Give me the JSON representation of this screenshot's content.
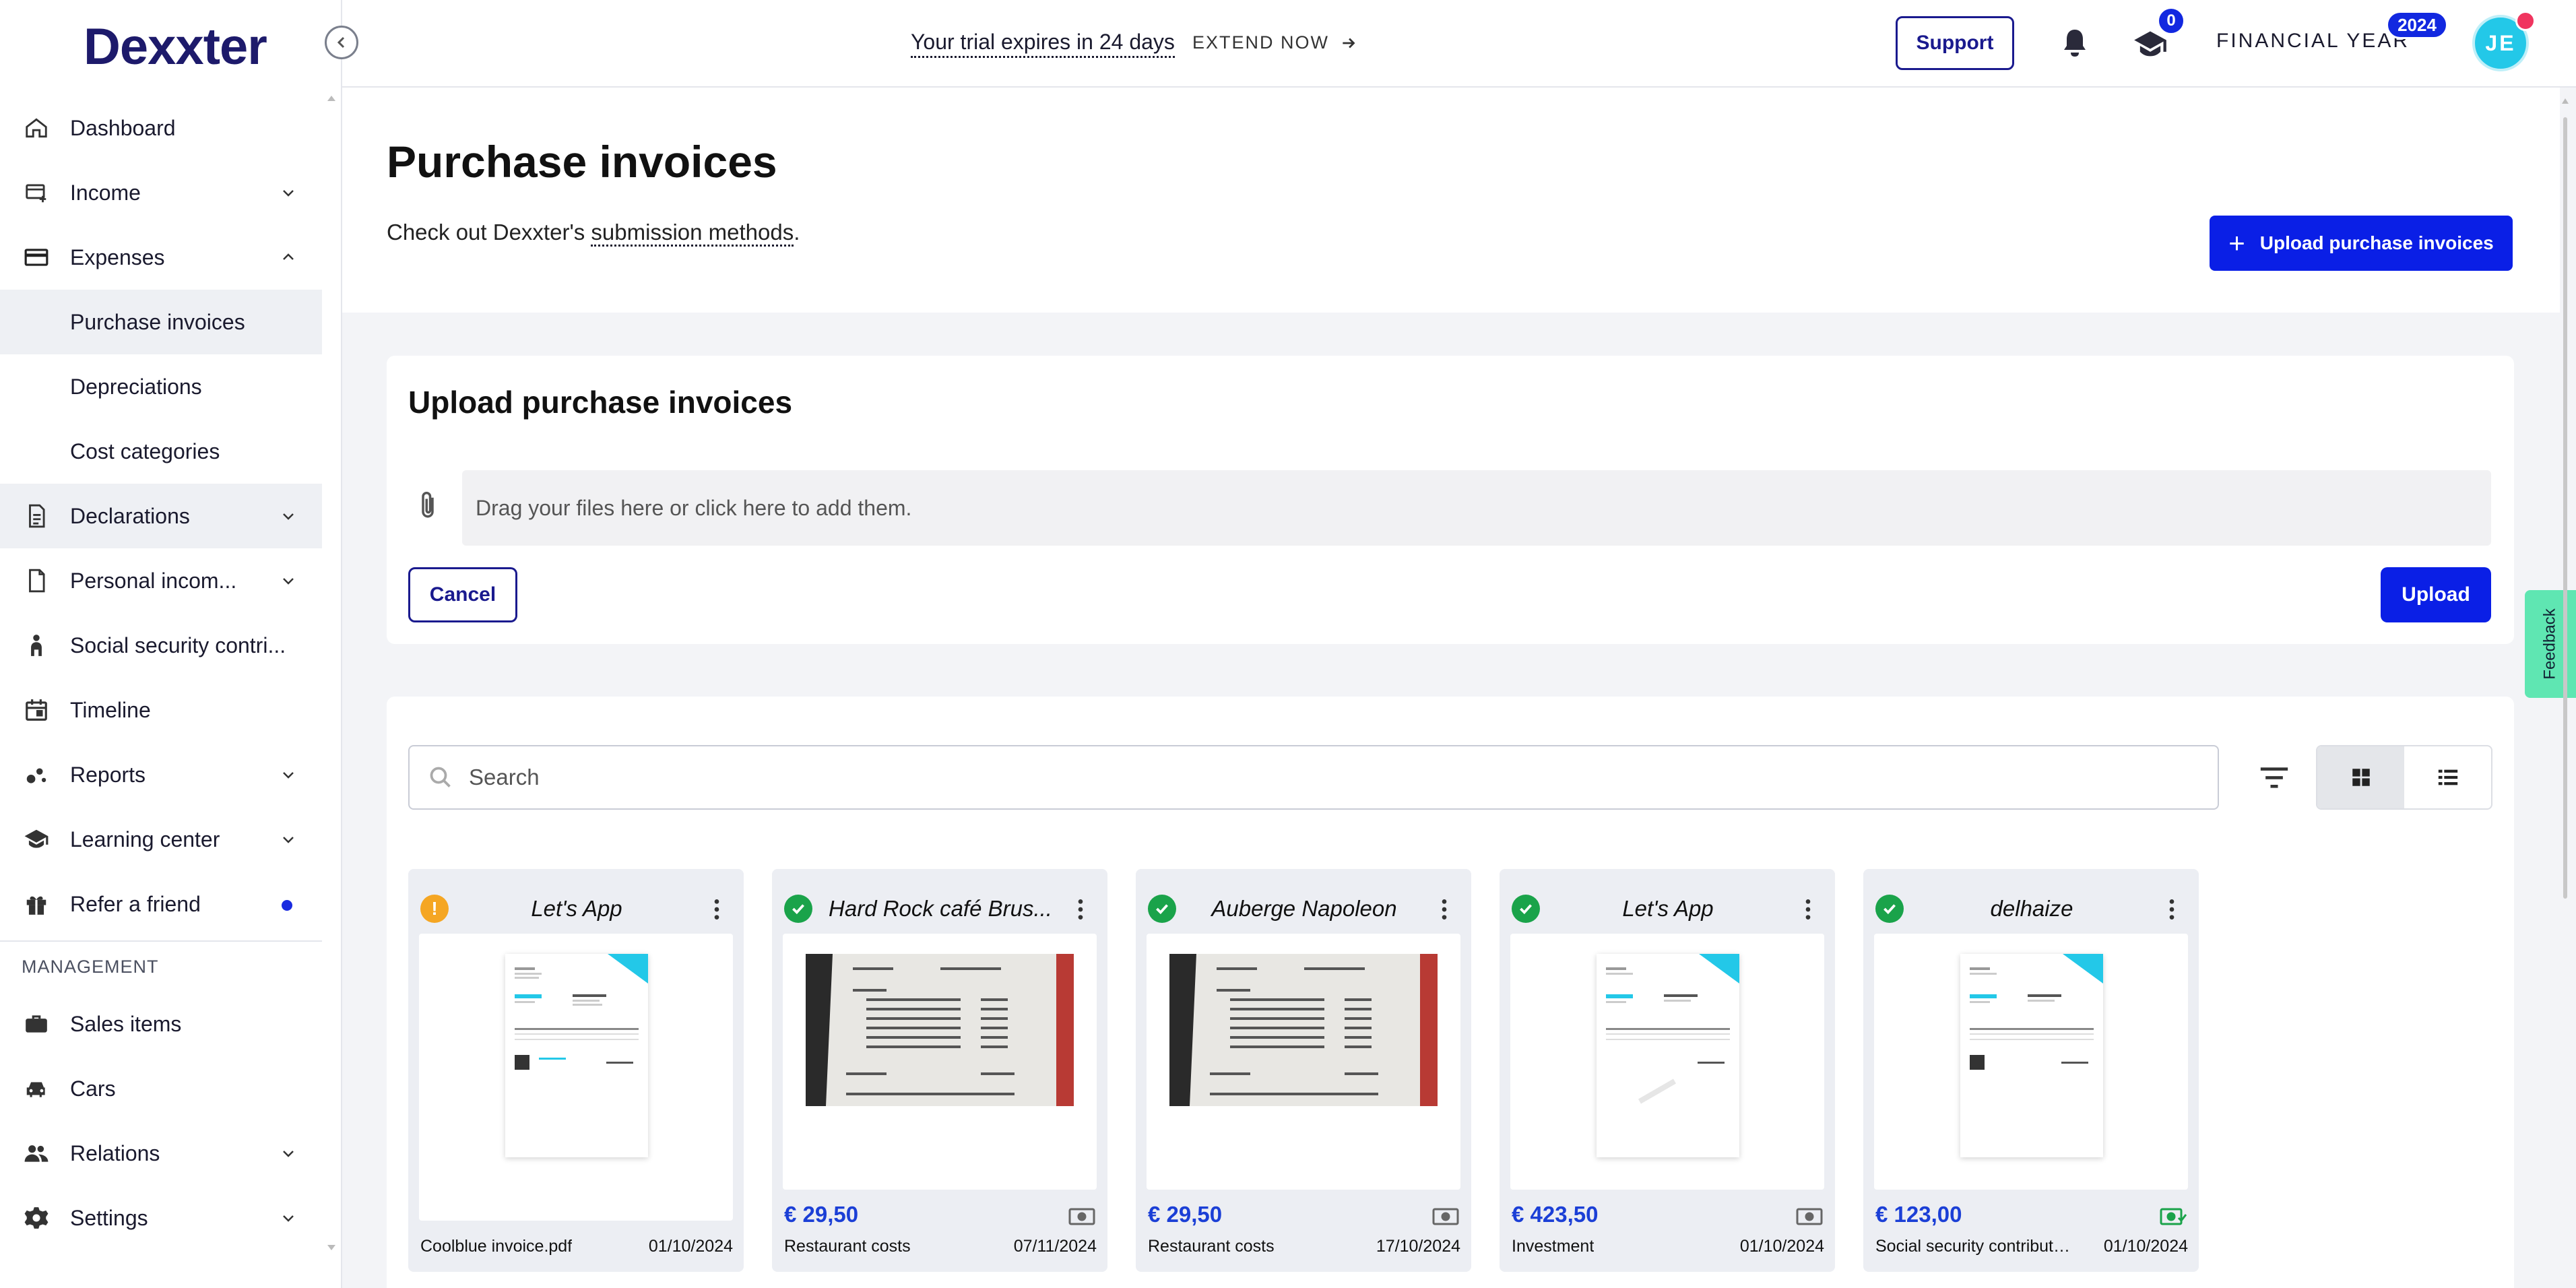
{
  "app": {
    "logo": "Dexxter"
  },
  "topbar": {
    "trial_text": "Your trial expires in 24 days",
    "extend_label": "EXTEND NOW",
    "support_label": "Support",
    "learning_badge": "0",
    "financial_year_label": "FINANCIAL YEAR",
    "financial_year_value": "2024",
    "avatar_initials": "JE"
  },
  "sidebar": {
    "items": [
      {
        "label": "Dashboard",
        "icon": "home-icon"
      },
      {
        "label": "Income",
        "icon": "income-icon"
      },
      {
        "label": "Expenses",
        "icon": "card-icon"
      },
      {
        "label": "Purchase invoices"
      },
      {
        "label": "Depreciations"
      },
      {
        "label": "Cost categories"
      },
      {
        "label": "Declarations",
        "icon": "document-icon"
      },
      {
        "label": "Personal incom...",
        "icon": "file-icon"
      },
      {
        "label": "Social security contri...",
        "icon": "person-icon"
      },
      {
        "label": "Timeline",
        "icon": "calendar-icon"
      },
      {
        "label": "Reports",
        "icon": "reports-icon"
      },
      {
        "label": "Learning center",
        "icon": "graduation-cap-icon"
      },
      {
        "label": "Refer a friend",
        "icon": "gift-icon"
      }
    ],
    "management_heading": "MANAGEMENT",
    "management_items": [
      {
        "label": "Sales items",
        "icon": "briefcase-icon"
      },
      {
        "label": "Cars",
        "icon": "car-icon"
      },
      {
        "label": "Relations",
        "icon": "people-icon"
      },
      {
        "label": "Settings",
        "icon": "gear-icon"
      }
    ]
  },
  "page": {
    "title": "Purchase invoices",
    "subtitle_prefix": "Check out Dexxter's ",
    "subtitle_link": "submission methods",
    "subtitle_suffix": ".",
    "upload_button": "Upload purchase invoices"
  },
  "upload": {
    "title": "Upload purchase invoices",
    "dropzone_text": "Drag your files here or click here to add them.",
    "cancel_label": "Cancel",
    "upload_label": "Upload"
  },
  "list": {
    "search_placeholder": "Search",
    "invoices": [
      {
        "name": "Let's App",
        "status": "warning",
        "amount": "",
        "category": "Coolblue invoice.pdf",
        "date": "01/10/2024"
      },
      {
        "name": "Hard Rock café Brus...",
        "status": "ok",
        "amount": "€ 29,50",
        "category": "Restaurant costs",
        "date": "07/11/2024"
      },
      {
        "name": "Auberge Napoleon",
        "status": "ok",
        "amount": "€ 29,50",
        "category": "Restaurant costs",
        "date": "17/10/2024"
      },
      {
        "name": "Let's App",
        "status": "ok",
        "amount": "€ 423,50",
        "category": "Investment",
        "date": "01/10/2024"
      },
      {
        "name": "delhaize",
        "status": "ok",
        "amount": "€ 123,00",
        "category": "Social security contribution...",
        "date": "01/10/2024"
      }
    ]
  },
  "feedback_label": "Feedback",
  "colors": {
    "primary": "#0a1fe6",
    "navy": "#1d1a6b",
    "success": "#1aa34a",
    "warning": "#f5a623",
    "feedback": "#5fe6b2"
  }
}
